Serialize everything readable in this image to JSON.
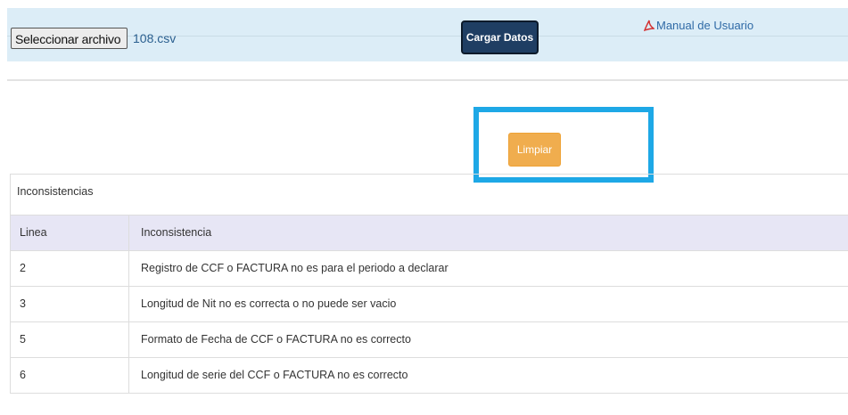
{
  "toolbar": {
    "file_button_label": "Seleccionar archivo",
    "file_name": "108.csv",
    "load_button_label": "Cargar Datos",
    "manual_link_label": "Manual de Usuario",
    "manual_icon": "pdf-icon"
  },
  "actions": {
    "clear_button_label": "Limpiar",
    "highlight_color": "#1ea8e6"
  },
  "table": {
    "caption": "Inconsistencias",
    "columns": [
      "Linea",
      "Inconsistencia"
    ],
    "rows": [
      {
        "line": "2",
        "text": "Registro de CCF o FACTURA no es para el periodo a declarar"
      },
      {
        "line": "3",
        "text": "Longitud de Nit no es correcta o no puede ser vacio"
      },
      {
        "line": "5",
        "text": "Formato de Fecha de CCF o FACTURA no es correcto"
      },
      {
        "line": "6",
        "text": "Longitud de serie del CCF o FACTURA no es correcto"
      }
    ]
  }
}
